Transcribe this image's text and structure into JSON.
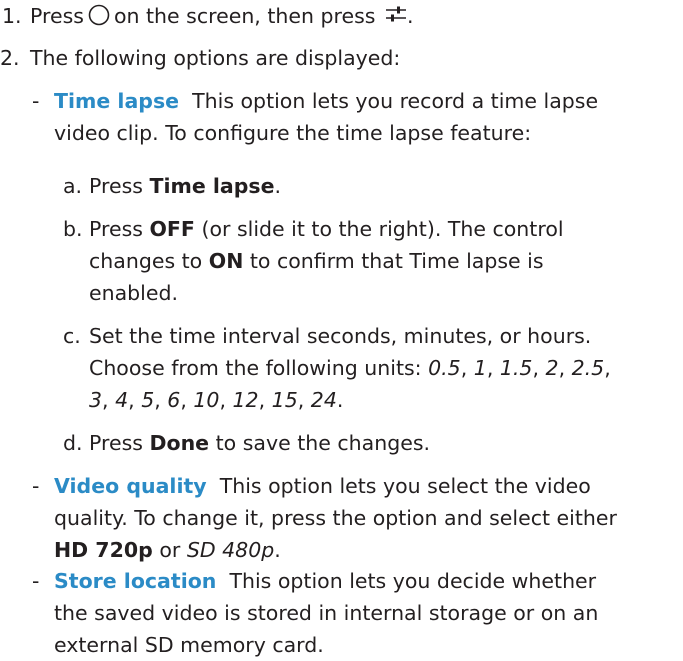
{
  "step1": {
    "num": "1.",
    "t1": "Press",
    "t2": "on the screen, then press",
    "t3": ".",
    "icon_a": "circle-outline-icon",
    "icon_b": "sliders-settings-icon"
  },
  "step2": {
    "num": "2.",
    "text": "The following options are displayed:"
  },
  "time_lapse": {
    "dash": "-",
    "title": "Time lapse",
    "desc_1": "This option lets you record a time lapse",
    "desc_2": "video clip. To configure the time lapse feature:",
    "a": {
      "letter": "a.",
      "t1": "Press",
      "b1": "Time lapse",
      "t2": "."
    },
    "b": {
      "letter": "b.",
      "t1": "Press",
      "b1": "OFF",
      "t2": "(or slide it to the right). The control",
      "t3": "changes to",
      "b2": "ON",
      "t4": "to confirm that Time lapse is",
      "t5": "enabled."
    },
    "c": {
      "letter": "c.",
      "t1": "Set the time interval seconds, minutes, or hours.",
      "t2": "Choose from the following units:",
      "units": [
        "0.5",
        "1",
        "1.5",
        "2",
        "2.5",
        "3",
        "4",
        "5",
        "6",
        "10",
        "12",
        "15",
        "24"
      ],
      "sep": ",",
      "end": "."
    },
    "d": {
      "letter": "d.",
      "t1": "Press",
      "b1": "Done",
      "t2": "to save the changes."
    }
  },
  "video_quality": {
    "dash": "-",
    "title": "Video quality",
    "desc_1": "This option lets you select the video",
    "desc_2": "quality. To change it, press the option and select either",
    "b1": "HD 720p",
    "or": "or",
    "i1": "SD 480p",
    "end": "."
  },
  "store_location": {
    "dash": "-",
    "title": "Store location",
    "desc_1": "This option lets you decide whether",
    "desc_2": "the saved video is stored in internal storage or on an",
    "desc_3": "external SD memory card."
  },
  "colors": {
    "text": "#231f20",
    "accent": "#2b8bc6"
  }
}
